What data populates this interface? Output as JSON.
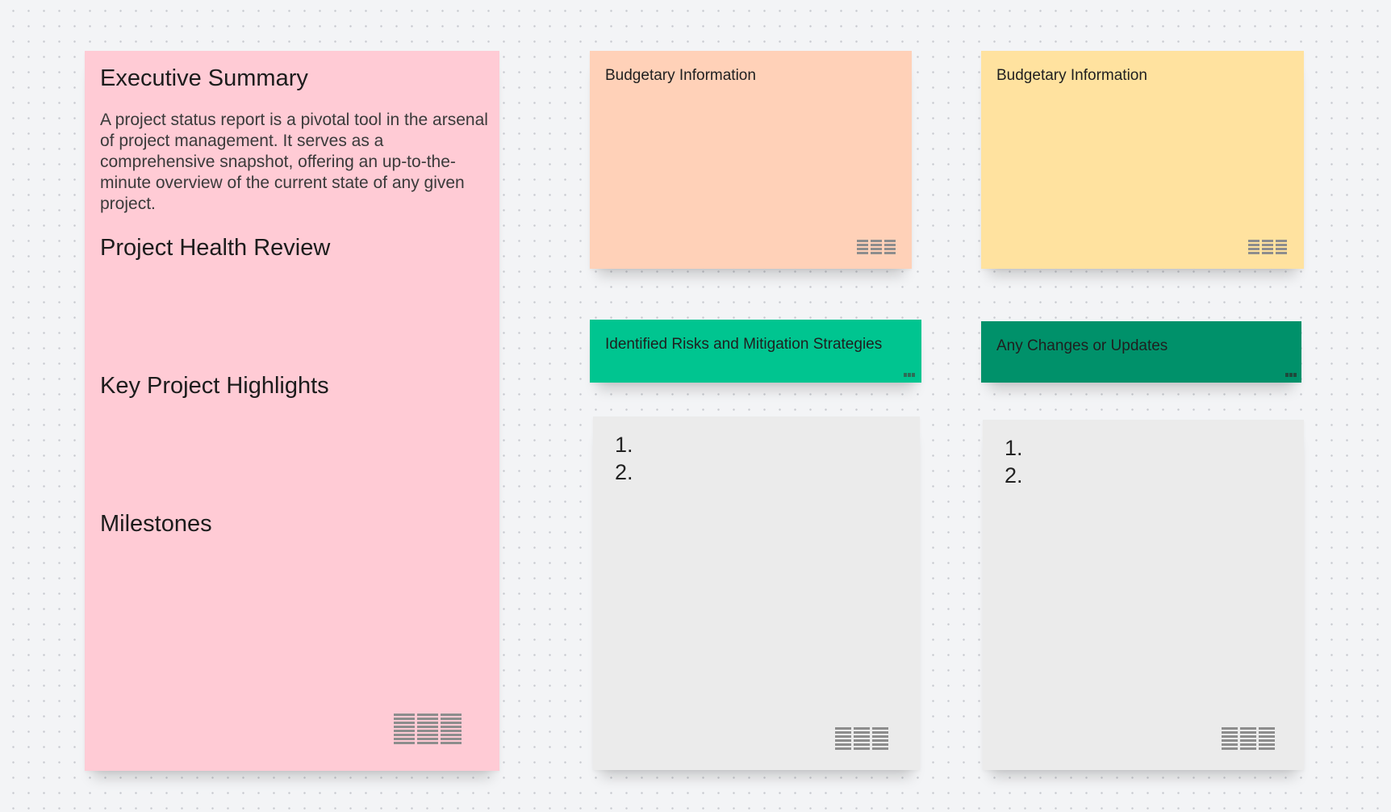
{
  "board": {
    "background_color": "#f3f4f6",
    "notes": {
      "executive": {
        "color": "#ffcbd5",
        "heading_summary": "Executive Summary",
        "summary_text": "A project status report is a pivotal tool in the arsenal of project management. It serves as a comprehensive snapshot, offering an up-to-the-minute overview of the current state of any given project.",
        "heading_health": "Project Health Review",
        "heading_highlights": "Key Project Highlights",
        "heading_milestones": "Milestones",
        "icon": "text-lines-icon"
      },
      "budget_orange": {
        "color": "#ffd1b8",
        "title": "Budgetary Information",
        "icon": "text-lines-icon"
      },
      "budget_yellow": {
        "color": "#ffe29f",
        "title": "Budgetary Information",
        "icon": "text-lines-icon"
      },
      "risks": {
        "color": "#00c590",
        "title": "Identified Risks and Mitigation Strategies",
        "icon": "text-lines-icon"
      },
      "changes": {
        "color": "#00916a",
        "title": "Any Changes or Updates",
        "icon": "text-lines-icon"
      },
      "list_left": {
        "color": "#ebebeb",
        "items": [
          "1.",
          "2."
        ],
        "icon": "text-lines-icon"
      },
      "list_right": {
        "color": "#ebebeb",
        "items": [
          "1.",
          "2."
        ],
        "icon": "text-lines-icon"
      }
    }
  }
}
